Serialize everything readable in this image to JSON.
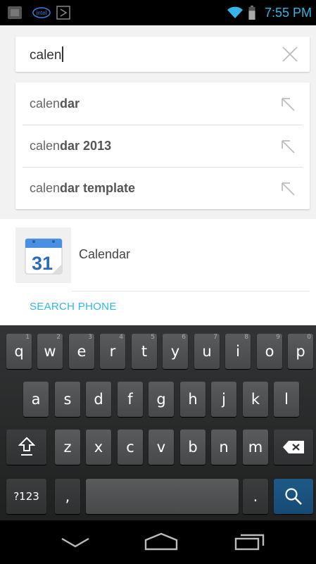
{
  "status_bar": {
    "time": "7:55 PM"
  },
  "search": {
    "query": "calen"
  },
  "suggestions": [
    {
      "prefix": "calen",
      "completion": "dar"
    },
    {
      "prefix": "calen",
      "completion": "dar 2013"
    },
    {
      "prefix": "calen",
      "completion": "dar template"
    }
  ],
  "results": {
    "app_label": "Calendar",
    "app_icon_day": "31",
    "search_phone_label": "SEARCH PHONE"
  },
  "keyboard": {
    "row1": [
      {
        "label": "q",
        "hint": "1"
      },
      {
        "label": "w",
        "hint": "2"
      },
      {
        "label": "e",
        "hint": "3"
      },
      {
        "label": "r",
        "hint": "4"
      },
      {
        "label": "t",
        "hint": "5"
      },
      {
        "label": "y",
        "hint": "6"
      },
      {
        "label": "u",
        "hint": "7"
      },
      {
        "label": "i",
        "hint": "8"
      },
      {
        "label": "o",
        "hint": "9"
      },
      {
        "label": "p",
        "hint": "0"
      }
    ],
    "row2": [
      "a",
      "s",
      "d",
      "f",
      "g",
      "h",
      "j",
      "k",
      "l"
    ],
    "row3": [
      "z",
      "x",
      "c",
      "v",
      "b",
      "n",
      "m"
    ],
    "symbols_label": "?123",
    "comma_label": ",",
    "period_label": "."
  },
  "icons": {
    "status": [
      "notification-icon",
      "intel-icon",
      "nfc-icon",
      "wifi-icon",
      "battery-icon"
    ],
    "nav": [
      "back-icon",
      "home-icon",
      "recents-icon"
    ]
  }
}
